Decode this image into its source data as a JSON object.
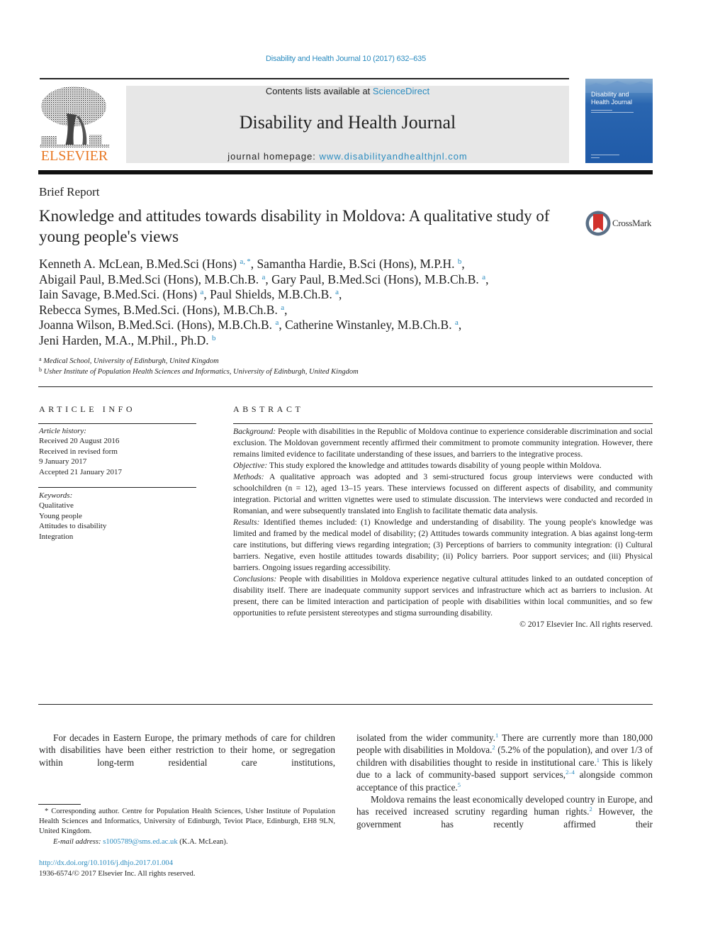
{
  "citation": "Disability and Health Journal 10 (2017) 632–635",
  "masthead": {
    "contents_prefix": "Contents lists available at ",
    "contents_link": "ScienceDirect",
    "journal_name": "Disability and Health Journal",
    "homepage_prefix": "journal homepage: ",
    "homepage_link": "www.disabilityandhealthjnl.com"
  },
  "publisher_logo": "ELSEVIER",
  "cover": {
    "title_line1": "Disability and",
    "title_line2": "Health Journal"
  },
  "crossmark_label": "CrossMark",
  "article": {
    "type": "Brief Report",
    "title": "Knowledge and attitudes towards disability in Moldova: A qualitative study of young people's views"
  },
  "authors": {
    "lines": [
      [
        {
          "name": "Kenneth A. McLean, B.Med.Sci (Hons)",
          "sup": "a, *",
          "sep": ", "
        },
        {
          "name": "Samantha Hardie, B.Sci (Hons), M.P.H.",
          "sup": "b",
          "sep": ","
        }
      ],
      [
        {
          "name": "Abigail Paul, B.Med.Sci (Hons), M.B.Ch.B.",
          "sup": "a",
          "sep": ", "
        },
        {
          "name": "Gary Paul, B.Med.Sci (Hons), M.B.Ch.B.",
          "sup": "a",
          "sep": ","
        }
      ],
      [
        {
          "name": "Iain Savage, B.Med.Sci. (Hons)",
          "sup": "a",
          "sep": ", "
        },
        {
          "name": "Paul Shields, M.B.Ch.B.",
          "sup": "a",
          "sep": ","
        }
      ],
      [
        {
          "name": "Rebecca Symes, B.Med.Sci. (Hons), M.B.Ch.B.",
          "sup": "a",
          "sep": ","
        }
      ],
      [
        {
          "name": "Joanna Wilson, B.Med.Sci. (Hons), M.B.Ch.B.",
          "sup": "a",
          "sep": ", "
        },
        {
          "name": "Catherine Winstanley, M.B.Ch.B.",
          "sup": "a",
          "sep": ","
        }
      ],
      [
        {
          "name": "Jeni Harden, M.A., M.Phil., Ph.D.",
          "sup": "b",
          "sep": ""
        }
      ]
    ]
  },
  "affiliations": [
    {
      "key": "a",
      "text": "Medical School, University of Edinburgh, United Kingdom"
    },
    {
      "key": "b",
      "text": "Usher Institute of Population Health Sciences and Informatics, University of Edinburgh, United Kingdom"
    }
  ],
  "article_info": {
    "heading": "ARTICLE INFO",
    "history_label": "Article history:",
    "history": [
      "Received 20 August 2016",
      "Received in revised form",
      "9 January 2017",
      "Accepted 21 January 2017"
    ],
    "keywords_label": "Keywords:",
    "keywords": [
      "Qualitative",
      "Young people",
      "Attitudes to disability",
      "Integration"
    ]
  },
  "abstract": {
    "heading": "ABSTRACT",
    "sections": [
      {
        "label": "Background:",
        "text": "People with disabilities in the Republic of Moldova continue to experience considerable discrimination and social exclusion. The Moldovan government recently affirmed their commitment to promote community integration. However, there remains limited evidence to facilitate understanding of these issues, and barriers to the integrative process."
      },
      {
        "label": "Objective:",
        "text": "This study explored the knowledge and attitudes towards disability of young people within Moldova."
      },
      {
        "label": "Methods:",
        "text": "A qualitative approach was adopted and 3 semi-structured focus group interviews were conducted with schoolchildren (n = 12), aged 13–15 years. These interviews focussed on different aspects of disability, and community integration. Pictorial and written vignettes were used to stimulate discussion. The interviews were conducted and recorded in Romanian, and were subsequently translated into English to facilitate thematic data analysis."
      },
      {
        "label": "Results:",
        "text": "Identified themes included: (1) Knowledge and understanding of disability. The young people's knowledge was limited and framed by the medical model of disability; (2) Attitudes towards community integration. A bias against long-term care institutions, but differing views regarding integration; (3) Perceptions of barriers to community integration: (i) Cultural barriers. Negative, even hostile attitudes towards disability; (ii) Policy barriers. Poor support services; and (iii) Physical barriers. Ongoing issues regarding accessibility."
      },
      {
        "label": "Conclusions:",
        "text": "People with disabilities in Moldova experience negative cultural attitudes linked to an outdated conception of disability itself. There are inadequate community support services and infrastructure which act as barriers to inclusion. At present, there can be limited interaction and participation of people with disabilities within local communities, and so few opportunities to refute persistent stereotypes and stigma surrounding disability."
      }
    ],
    "copyright": "© 2017 Elsevier Inc. All rights reserved."
  },
  "body": {
    "left_para": "For decades in Eastern Europe, the primary methods of care for children with disabilities have been either restriction to their home, or segregation within long-term residential care institutions,",
    "right_para1": [
      {
        "t": "isolated from the wider community."
      },
      {
        "sup": "1"
      },
      {
        "t": " There are currently more than 180,000 people with disabilities in Moldova."
      },
      {
        "sup": "2"
      },
      {
        "t": " (5.2% of the population), and over 1/3 of children with disabilities thought to reside in institutional care."
      },
      {
        "sup": "1"
      },
      {
        "t": " This is likely due to a lack of community-based support services,"
      },
      {
        "sup": "2–4"
      },
      {
        "t": " alongside common acceptance of this practice."
      },
      {
        "sup": "5"
      }
    ],
    "right_para2": [
      {
        "t": "Moldova remains the least economically developed country in Europe, and has received increased scrutiny regarding human rights."
      },
      {
        "sup": "2"
      },
      {
        "t": " However, the government has recently affirmed their"
      }
    ]
  },
  "footnote": {
    "marker": "*",
    "text": "Corresponding author. Centre for Population Health Sciences, Usher Institute of Population Health Sciences and Informatics, University of Edinburgh, Teviot Place, Edinburgh, EH8 9LN, United Kingdom.",
    "email_label": "E-mail address:",
    "email": "s1005789@sms.ed.ac.uk",
    "email_suffix": " (K.A. McLean)."
  },
  "doi": "http://dx.doi.org/10.1016/j.dhjo.2017.01.004",
  "issn_line": "1936-6574/© 2017 Elsevier Inc. All rights reserved."
}
